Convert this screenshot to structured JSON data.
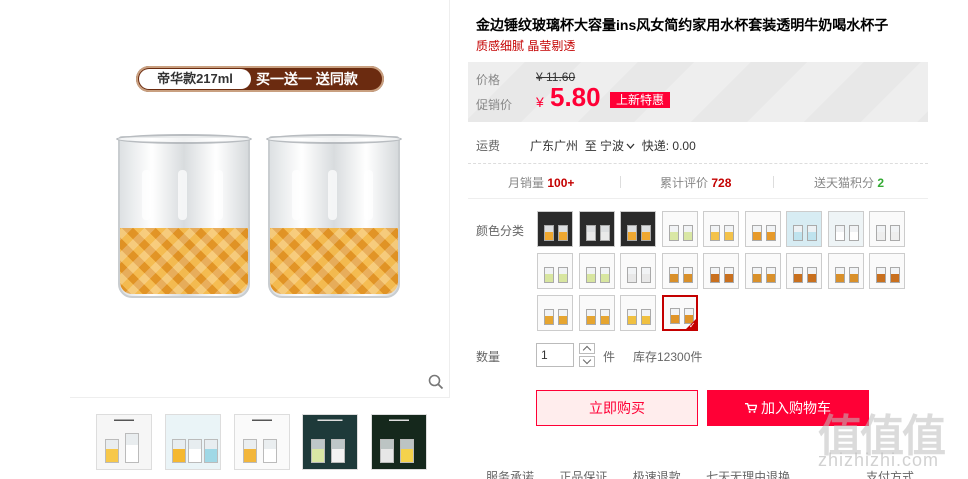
{
  "gallery": {
    "promo": {
      "left": "帝华款217ml",
      "right": "买一送一  送同款"
    }
  },
  "product": {
    "title": "金边锤纹玻璃杯大容量ins风女简约家用水杯套装透明牛奶喝水杯子",
    "subtitle": "质感细腻 晶莹剔透"
  },
  "price": {
    "label_original": "价格",
    "original": "¥ 11.60",
    "label_promo": "促销价",
    "currency": "¥",
    "promo": "5.80",
    "badge": "上新特惠"
  },
  "shipping": {
    "label": "运费",
    "from": "广东广州",
    "to_prefix": "至",
    "to": "宁波",
    "method": "快递: 0.00"
  },
  "stats": {
    "monthly_sales_label": "月销量",
    "monthly_sales": "100+",
    "reviews_label": "累计评价",
    "reviews": "728",
    "points_label": "送天猫积分",
    "points": "2"
  },
  "options": {
    "color_label": "颜色分类",
    "swatch_count": 22,
    "selected_index": 21
  },
  "quantity": {
    "label": "数量",
    "value": "1",
    "unit": "件",
    "stock": "库存12300件"
  },
  "actions": {
    "buy_now": "立即购买",
    "add_to_cart": "加入购物车"
  },
  "service": {
    "items": [
      "服务承诺",
      "正品保证",
      "极速退款",
      "七天无理由退换"
    ],
    "payment": "支付方式"
  },
  "watermark": {
    "logo": "值值值",
    "url": "zhizhizhi.com"
  },
  "colors": {
    "accent": "#ff0036",
    "title_red": "#c40000",
    "promo_brown": "#6b2b10"
  }
}
